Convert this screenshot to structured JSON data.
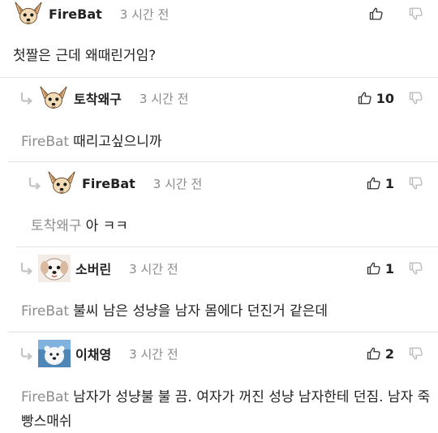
{
  "comments": [
    {
      "author": "FireBat",
      "time": "3 시간 전",
      "votes": "",
      "mention": "",
      "text": "첫짤은 근데 왜때린거임?"
    },
    {
      "author": "토착왜구",
      "time": "3 시간 전",
      "votes": "10",
      "mention": "FireBat",
      "text": "때리고싶으니까"
    },
    {
      "author": "FireBat",
      "time": "3 시간 전",
      "votes": "1",
      "mention": "토착왜구",
      "text": "아 ㅋㅋ"
    },
    {
      "author": "소버린",
      "time": "3 시간 전",
      "votes": "1",
      "mention": "FireBat",
      "text": "불씨 남은 성냥을 남자 몸에다 던진거 같은데"
    },
    {
      "author": "이채영",
      "time": "3 시간 전",
      "votes": "2",
      "mention": "FireBat",
      "text": "남자가 성냥불 불 끔. 여자가 꺼진 성냥 남자한테 던짐. 남자 죽빵스매쉬"
    }
  ],
  "colors": {
    "text": "#222222",
    "muted": "#8d8d8d",
    "separator": "#e3e3e3",
    "icon": "#333333",
    "icon_light": "#b8b8b8"
  },
  "icons": {
    "upvote": "thumbs-up-icon",
    "downvote": "thumbs-down-icon",
    "reply": "reply-arrow-icon",
    "avatar_dog": "chihuahua-avatar",
    "avatar_puppy": "puppy-avatar",
    "avatar_polar": "polar-bear-avatar"
  }
}
